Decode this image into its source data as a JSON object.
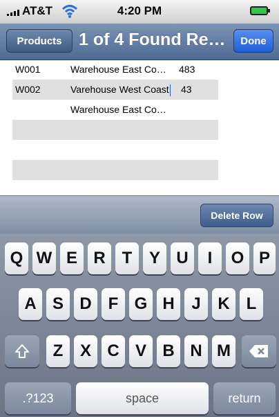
{
  "status_bar": {
    "carrier": "AT&T",
    "time": "4:20 PM"
  },
  "nav": {
    "back_label": "Products",
    "title": "1 of 4 Found Re…",
    "done_label": "Done"
  },
  "rows": [
    {
      "code": "W001",
      "name": "Warehouse East Co…",
      "qty": "483"
    },
    {
      "code": "W002",
      "name": "Varehouse West Coast",
      "qty": "43"
    },
    {
      "code": "",
      "name": "Warehouse East Co…",
      "qty": ""
    },
    {
      "code": "",
      "name": "",
      "qty": ""
    },
    {
      "code": "",
      "name": "",
      "qty": ""
    },
    {
      "code": "",
      "name": "",
      "qty": ""
    },
    {
      "code": "",
      "name": "",
      "qty": ""
    }
  ],
  "toolbar": {
    "delete_row_label": "Delete Row"
  },
  "keyboard": {
    "row1": [
      "Q",
      "W",
      "E",
      "R",
      "T",
      "Y",
      "U",
      "I",
      "O",
      "P"
    ],
    "row2": [
      "A",
      "S",
      "D",
      "F",
      "G",
      "H",
      "J",
      "K",
      "L"
    ],
    "row3": [
      "Z",
      "X",
      "C",
      "V",
      "B",
      "N",
      "M"
    ],
    "numbers_label": ".?123",
    "space_label": "space",
    "return_label": "return",
    "shift_icon": "shift-arrow",
    "backspace_icon": "backspace"
  }
}
